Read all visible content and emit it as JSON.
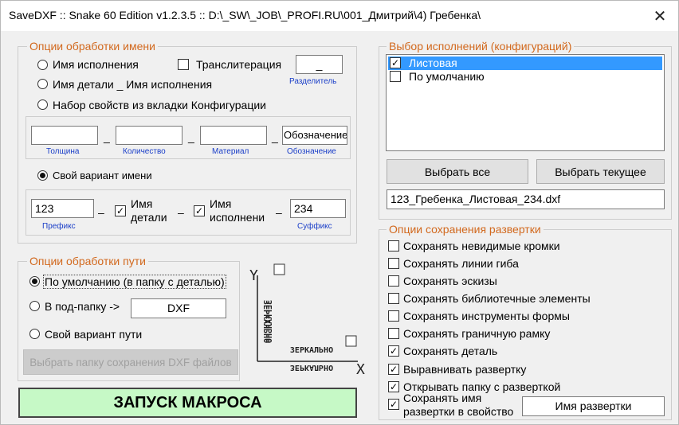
{
  "window": {
    "title": "SaveDXF :: Snake 60 Edition v1.2.3.5 ::   D:\\_SW\\_JOB\\_PROFI.RU\\001_Дмитрий\\4) Гребенка\\",
    "close_glyph": "✕"
  },
  "name_options": {
    "legend": "Опции обработки имени",
    "radio_config_name": "Имя исполнения",
    "checkbox_translit": "Транслитерация",
    "separator_value": "_",
    "separator_label": "Разделитель",
    "radio_part_config": "Имя детали _ Имя исполнения",
    "radio_props": "Набор свойств из вкладки Конфигурации",
    "props_fields": [
      {
        "value": "",
        "label": "Толщина"
      },
      {
        "value": "",
        "label": "Количество"
      },
      {
        "value": "",
        "label": "Материал"
      },
      {
        "value": "Обозначение",
        "label": "Обозначение"
      }
    ],
    "props_sep": "_",
    "radio_custom": "Свой вариант имени",
    "prefix_value": "123",
    "prefix_label": "Префикс",
    "check_part_name_l1": "Имя",
    "check_part_name_l2": "детали",
    "check_config_name_l1": "Имя",
    "check_config_name_l2": "исполнени",
    "suffix_value": "234",
    "suffix_label": "Суффикс",
    "custom_sep": "–"
  },
  "config_select": {
    "legend": "Выбор исполнений (конфигураций)",
    "items": [
      {
        "label": "Листовая",
        "checked": true,
        "selected": true
      },
      {
        "label": "По умолчанию",
        "checked": false,
        "selected": false
      }
    ],
    "select_all": "Выбрать все",
    "select_current": "Выбрать текущее",
    "result_name": "123_Гребенка_Листовая_234.dxf"
  },
  "path_options": {
    "legend": "Опции обработки пути",
    "radio_default": "По умолчанию (в папку с деталью)",
    "radio_subfolder": "В под-папку ->",
    "subfolder_value": "DXF",
    "radio_custom": "Свой вариант пути",
    "choose_folder": "Выбрать папку сохранения DXF файлов"
  },
  "mirror": {
    "axis_y": "Y",
    "axis_x": "X",
    "vertical_text": "ЗЕРКАЛЬНО",
    "horizontal_text": "ЗЕРКАЛЬНО"
  },
  "start_button": "ЗАПУСК МАКРОСА",
  "save_options": {
    "legend": "Опции сохранения развертки",
    "items": [
      {
        "label": "Сохранять невидимые кромки",
        "checked": false
      },
      {
        "label": "Сохранять линии гиба",
        "checked": false
      },
      {
        "label": "Сохранять эскизы",
        "checked": false
      },
      {
        "label": "Сохранять библиотечные элементы",
        "checked": false
      },
      {
        "label": "Сохранять инструменты формы",
        "checked": false
      },
      {
        "label": "Сохранять граничную рамку",
        "checked": false
      },
      {
        "label": "Сохранять деталь",
        "checked": true
      },
      {
        "label": "Выравнивать развертку",
        "checked": true
      },
      {
        "label": "Открывать папку с разверткой",
        "checked": true
      }
    ],
    "save_name_l1": "Сохранять имя",
    "save_name_l2": "развертки в свойство",
    "save_name_checked": true,
    "property_name": "Имя развертки"
  },
  "colors": {
    "legend": "#d2691e",
    "caption_blue": "#1a3ec8",
    "selection": "#3399ff",
    "start_bg": "#c6f9c6"
  }
}
